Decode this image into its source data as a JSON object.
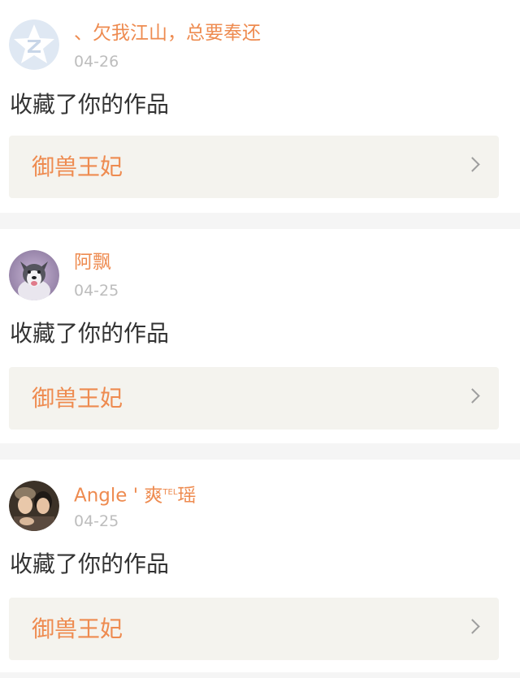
{
  "feed": {
    "items": [
      {
        "username": "、欠我江山，总要奉还",
        "date": "04-26",
        "action": "收藏了你的作品",
        "work_title": "御兽王妃",
        "avatar_icon": "default-qq-avatar-icon"
      },
      {
        "username": "阿飘",
        "date": "04-25",
        "action": "收藏了你的作品",
        "work_title": "御兽王妃",
        "avatar_icon": "husky-dog-avatar"
      },
      {
        "username_main": "Angle ' 爽",
        "username_sup": "TEL",
        "username_end": "瑶",
        "date": "04-25",
        "action": "收藏了你的作品",
        "work_title": "御兽王妃",
        "avatar_icon": "two-girls-photo-avatar"
      }
    ]
  },
  "colors": {
    "accent": "#ee8b50",
    "date": "#bdbdbd",
    "text": "#333333",
    "link_bg": "#f4f3ee",
    "separator": "#f5f5f5"
  }
}
